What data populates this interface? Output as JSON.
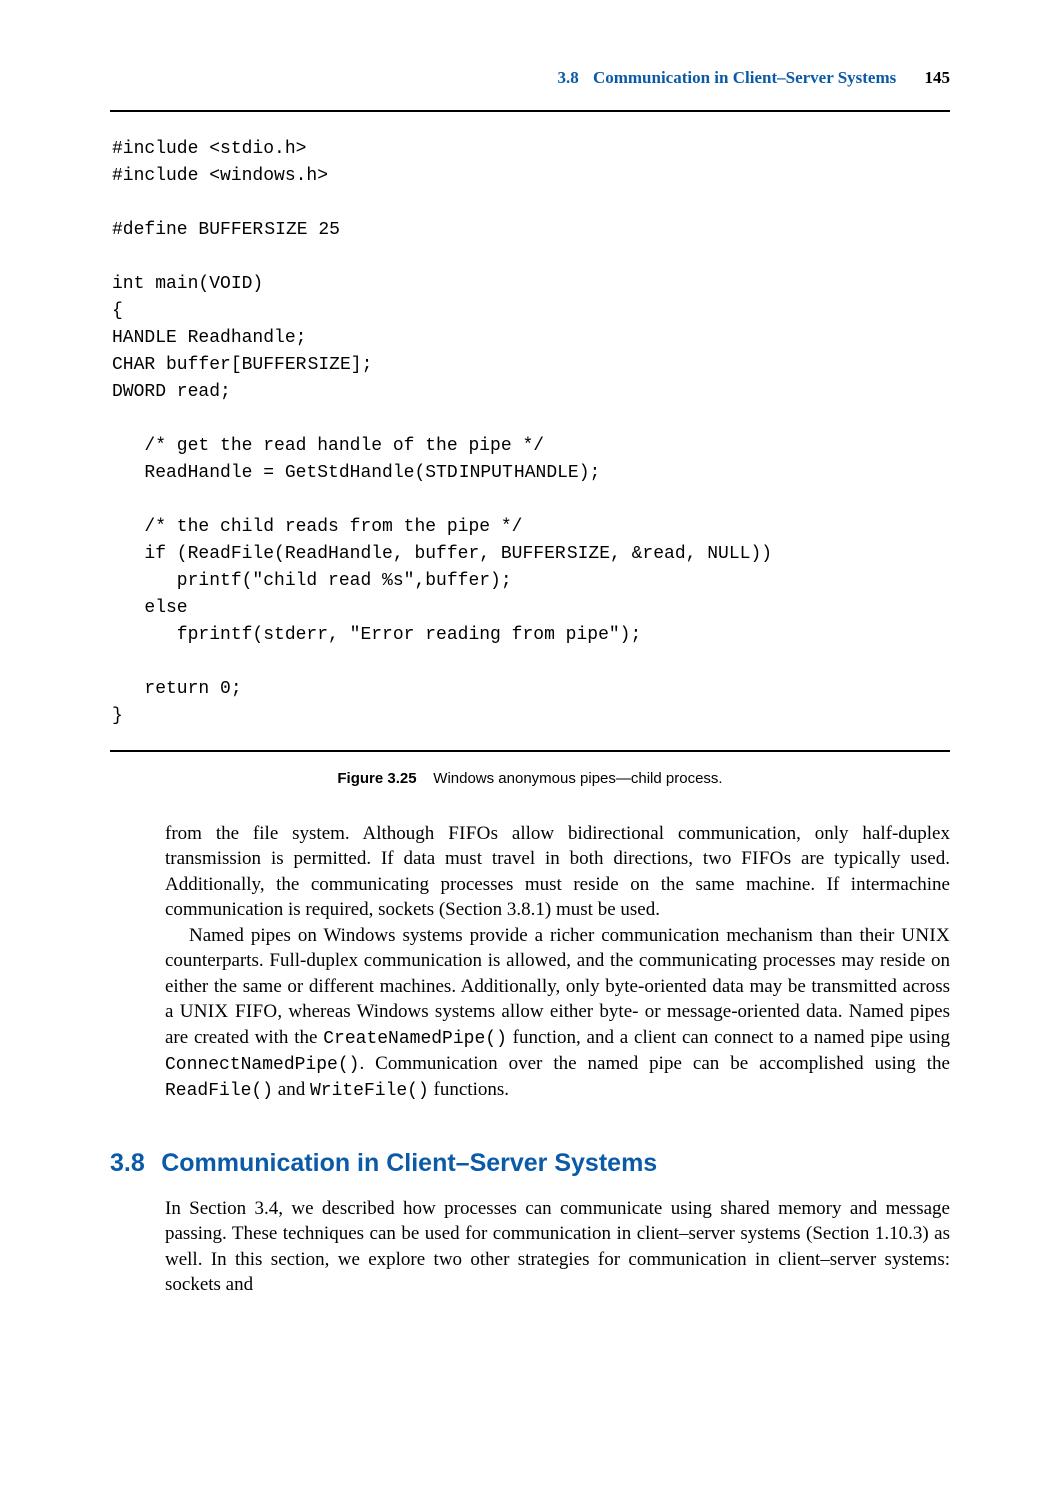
{
  "header": {
    "section_num": "3.8",
    "section_title": "Communication in Client–Server Systems",
    "page_num": "145"
  },
  "code": {
    "l1": "#include <stdio.h>",
    "l2": "#include <windows.h>",
    "l3": "",
    "l4a": "#define BUFFER",
    "l4b": "SIZE 25",
    "l5": "",
    "l6": "int main(VOID)",
    "l7": "{",
    "l8": "HANDLE Readhandle;",
    "l9a": "CHAR buffer[BUFFER",
    "l9b": "SIZE];",
    "l10": "DWORD read;",
    "l11": "",
    "l12": "   /* get the read handle of the pipe */",
    "l13a": "   ReadHandle = GetStdHandle(STD",
    "l13b": "INPUT",
    "l13c": "HANDLE);",
    "l14": "",
    "l15": "   /* the child reads from the pipe */",
    "l16a": "   if (ReadFile(ReadHandle, buffer, BUFFER",
    "l16b": "SIZE, &read, NULL))",
    "l17": "      printf(\"child read %s\",buffer);",
    "l18": "   else",
    "l19": "      fprintf(stderr, \"Error reading from pipe\");",
    "l20": "",
    "l21": "   return 0;",
    "l22": "}"
  },
  "figure": {
    "label": "Figure 3.25",
    "caption": "Windows anonymous pipes—child process."
  },
  "p1": {
    "t1": "from the file system. Although ",
    "fifo1": "FIFO",
    "t2": "s allow bidirectional communication, only half-duplex transmission is permitted. If data must travel in both directions, two ",
    "fifo2": "FIFO",
    "t3": "s are typically used. Additionally, the communicating processes must reside on the same machine. If intermachine communication is required, sockets (Section 3.8.1) must be used."
  },
  "p2": {
    "t1": "Named pipes on Windows systems provide a richer communication mechanism than their ",
    "unix1": "UNIX",
    "t2": " counterparts. Full-duplex communication is allowed, and the communicating processes may reside on either the same or different machines. Additionally, only byte-oriented data may be transmitted across a ",
    "unix2": "UNIX FIFO",
    "t3": ", whereas Windows systems allow either byte- or message-oriented data. Named pipes are created with the ",
    "fn1": "CreateNamedPipe()",
    "t4": " function, and a client can connect to a named pipe using ",
    "fn2": "ConnectNamedPipe()",
    "t5": ". Communication over the named pipe can be accomplished using the ",
    "fn3": "ReadFile()",
    "t6": " and ",
    "fn4": "WriteFile()",
    "t7": " functions."
  },
  "section": {
    "num": "3.8",
    "title": "Communication in Client–Server Systems"
  },
  "p3": {
    "t1": "In Section 3.4, we described how processes can communicate using shared memory and message passing. These techniques can be used for communication in client–server systems (Section 1.10.3) as well. In this section, we explore two other strategies for communication in client–server systems: sockets and"
  }
}
